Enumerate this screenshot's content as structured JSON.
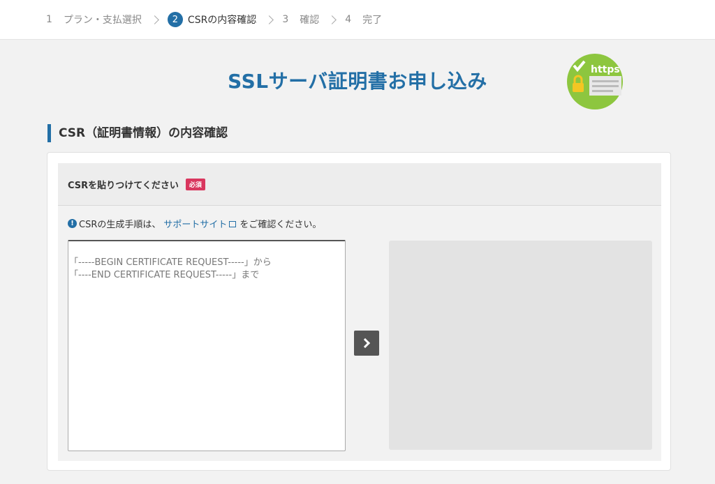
{
  "stepper": {
    "steps": [
      {
        "num": "1",
        "label": "プラン・支払選択"
      },
      {
        "num": "2",
        "label": "CSRの内容確認"
      },
      {
        "num": "3",
        "label": "確認"
      },
      {
        "num": "4",
        "label": "完了"
      }
    ]
  },
  "page": {
    "title": "SSLサーバ証明書お申し込み",
    "logo_text": "https",
    "section_title": "CSR（証明書情報）の内容確認"
  },
  "form": {
    "field_label": "CSRを貼りつけてください",
    "required_badge": "必須",
    "help_prefix": "CSRの生成手順は、",
    "help_link": "サポートサイト",
    "help_suffix": "をご確認ください。",
    "csr_placeholder": "「-----BEGIN CERTIFICATE REQUEST-----」から\n「----END CERTIFICATE REQUEST-----」まで"
  },
  "colors": {
    "accent": "#236fa6",
    "required": "#d9365e",
    "logo_green": "#8dc63f"
  },
  "icons": {
    "info": "info-circle-icon",
    "external": "external-link-icon",
    "arrow": "chevron-right-icon"
  }
}
